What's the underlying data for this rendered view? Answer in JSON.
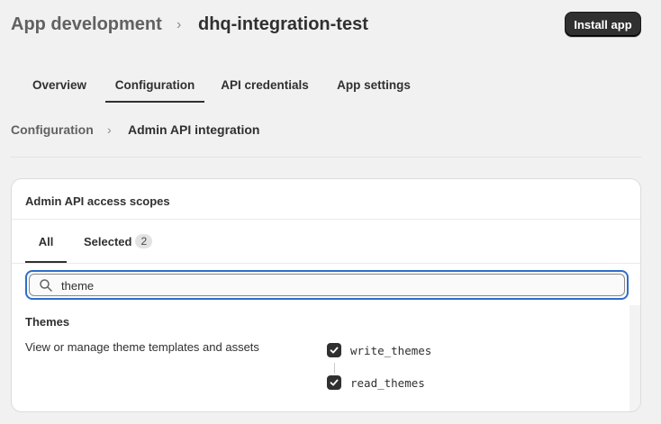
{
  "header": {
    "breadcrumb_root": "App development",
    "breadcrumb_separator": "›",
    "breadcrumb_current": "dhq-integration-test",
    "install_button": "Install app"
  },
  "tabs": [
    {
      "label": "Overview",
      "active": false
    },
    {
      "label": "Configuration",
      "active": true
    },
    {
      "label": "API credentials",
      "active": false
    },
    {
      "label": "App settings",
      "active": false
    }
  ],
  "subcrumb": {
    "root": "Configuration",
    "separator": "›",
    "current": "Admin API integration"
  },
  "card": {
    "title": "Admin API access scopes",
    "tabs": {
      "all": "All",
      "selected": "Selected",
      "selected_count": "2"
    },
    "search": {
      "value": "theme",
      "icon": "search-icon"
    },
    "group": {
      "title": "Themes",
      "description": "View or manage theme templates and assets",
      "scopes": [
        {
          "name": "write_themes",
          "checked": true
        },
        {
          "name": "read_themes",
          "checked": true
        }
      ]
    }
  },
  "colors": {
    "background": "#f1f1f1",
    "primary_button": "#303030",
    "focus_ring": "#2c6ecb",
    "checkbox": "#303030"
  }
}
